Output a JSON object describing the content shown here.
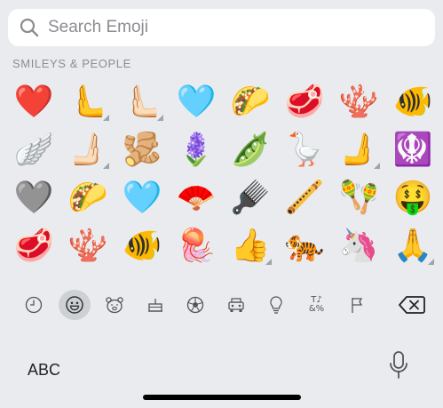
{
  "search": {
    "placeholder": "Search Emoji"
  },
  "section": {
    "title": "SMILEYS & PEOPLE"
  },
  "emoji_rows": [
    [
      {
        "char": "❤️",
        "name": "pink-heart-emoji",
        "variant": false
      },
      {
        "char": "🫷",
        "name": "pushing-hand-emoji",
        "variant": true
      },
      {
        "char": "🫷🏻",
        "name": "pushing-hand-light-emoji",
        "variant": true
      },
      {
        "char": "🩵",
        "name": "light-blue-heart-emoji",
        "variant": false
      },
      {
        "char": "🌮",
        "name": "taco-emoji",
        "variant": false
      },
      {
        "char": "🥩",
        "name": "cut-of-meat-emoji",
        "variant": false
      },
      {
        "char": "🪸",
        "name": "coral-emoji",
        "variant": false
      },
      {
        "char": "🐠",
        "name": "tropical-fish-emoji",
        "variant": false
      }
    ],
    [
      {
        "char": "🪽",
        "name": "wing-emoji",
        "variant": false
      },
      {
        "char": "🫸🏻",
        "name": "rightwards-pushing-hand-light-emoji",
        "variant": true
      },
      {
        "char": "🫚",
        "name": "ginger-root-emoji",
        "variant": false
      },
      {
        "char": "🪻",
        "name": "hyacinth-emoji",
        "variant": false
      },
      {
        "char": "🫛",
        "name": "pea-pod-emoji",
        "variant": false
      },
      {
        "char": "🪿",
        "name": "goose-emoji",
        "variant": false
      },
      {
        "char": "🫸",
        "name": "rightwards-pushing-hand-emoji",
        "variant": true
      },
      {
        "char": "🪯",
        "name": "khanda-emoji",
        "variant": false
      }
    ],
    [
      {
        "char": "🩶",
        "name": "grey-heart-emoji",
        "variant": false
      },
      {
        "char": "🌮",
        "name": "taco-emoji",
        "variant": false
      },
      {
        "char": "🩵",
        "name": "light-blue-heart-emoji",
        "variant": false
      },
      {
        "char": "🪭",
        "name": "folding-hand-fan-emoji",
        "variant": false
      },
      {
        "char": "🪮",
        "name": "hair-pick-emoji",
        "variant": false
      },
      {
        "char": "🪈",
        "name": "flute-emoji",
        "variant": false
      },
      {
        "char": "🪇",
        "name": "maracas-emoji",
        "variant": false
      },
      {
        "char": "🤑",
        "name": "money-mouth-face-emoji",
        "variant": false
      }
    ],
    [
      {
        "char": "🥩",
        "name": "cut-of-meat-emoji",
        "variant": false
      },
      {
        "char": "🪸",
        "name": "coral-emoji",
        "variant": false
      },
      {
        "char": "🐠",
        "name": "tropical-fish-emoji",
        "variant": false
      },
      {
        "char": "🪼",
        "name": "jellyfish-emoji",
        "variant": false
      },
      {
        "char": "👍",
        "name": "thumbs-up-emoji",
        "variant": true
      },
      {
        "char": "🐅",
        "name": "tiger-emoji",
        "variant": false
      },
      {
        "char": "🦄",
        "name": "unicorn-emoji",
        "variant": false
      },
      {
        "char": "🙏",
        "name": "folded-hands-emoji",
        "variant": true
      }
    ]
  ],
  "categories": [
    {
      "icon": "clock-icon",
      "active": false
    },
    {
      "icon": "smiley-icon",
      "active": true
    },
    {
      "icon": "bear-icon",
      "active": false
    },
    {
      "icon": "cake-icon",
      "active": false
    },
    {
      "icon": "soccer-ball-icon",
      "active": false
    },
    {
      "icon": "car-icon",
      "active": false
    },
    {
      "icon": "lightbulb-icon",
      "active": false
    },
    {
      "icon": "symbols-icon",
      "active": false
    },
    {
      "icon": "flag-icon",
      "active": false
    }
  ],
  "symbols_icon_text": {
    "top": "T♪",
    "bottom": "&%"
  },
  "keyboard": {
    "abc_label": "ABC"
  },
  "colors": {
    "background": "#e9ebef",
    "active_category_bg": "#cdd0d5",
    "icon_gray": "#555555"
  }
}
